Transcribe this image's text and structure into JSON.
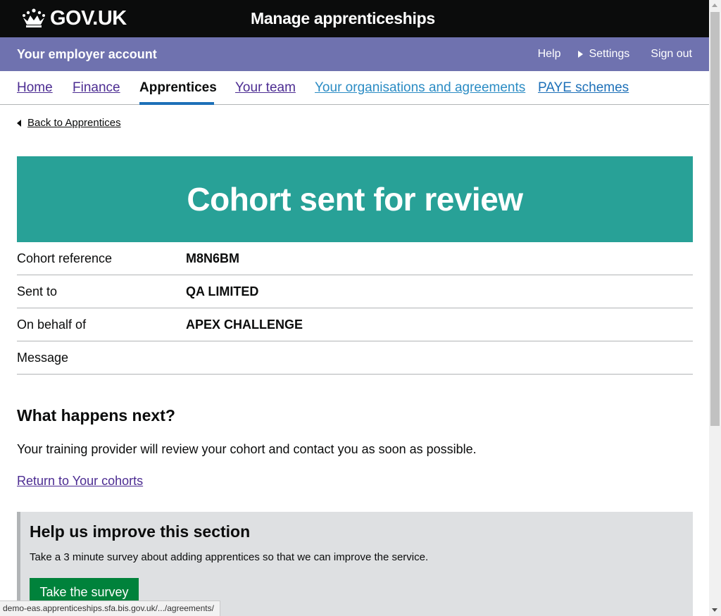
{
  "header": {
    "logo_text": "GOV.UK",
    "service_name": "Manage apprenticeships"
  },
  "account_bar": {
    "title": "Your employer account",
    "links": {
      "help": "Help",
      "settings": "Settings",
      "sign_out": "Sign out"
    }
  },
  "nav": {
    "items": [
      {
        "label": "Home",
        "active": false
      },
      {
        "label": "Finance",
        "active": false
      },
      {
        "label": "Apprentices",
        "active": true
      },
      {
        "label": "Your team",
        "active": false
      },
      {
        "label": "Your organisations and agreements",
        "active": false
      },
      {
        "label": "PAYE schemes",
        "active": false
      }
    ]
  },
  "back_link": "Back to Apprentices",
  "panel": {
    "title": "Cohort sent for review"
  },
  "summary": [
    {
      "key": "Cohort reference",
      "value": "M8N6BM"
    },
    {
      "key": "Sent to",
      "value": "QA LIMITED"
    },
    {
      "key": "On behalf of",
      "value": "APEX CHALLENGE"
    },
    {
      "key": "Message",
      "value": ""
    }
  ],
  "next_steps": {
    "heading": "What happens next?",
    "text": "Your training provider will review your cohort and contact you as soon as possible.",
    "link": "Return to Your cohorts"
  },
  "survey": {
    "heading": "Help us improve this section",
    "text": "Take a 3 minute survey about adding apprentices so that we can improve the service.",
    "button": "Take the survey"
  },
  "status_bar": {
    "url": "demo-eas.apprenticeships.sfa.bis.gov.uk/.../agreements/"
  },
  "colors": {
    "header_bg": "#0b0c0c",
    "account_bar_bg": "#6f72af",
    "panel_bg": "#28a197",
    "link_visited": "#4c2c92",
    "survey_bg": "#dee0e2",
    "button_green": "#00823b"
  }
}
